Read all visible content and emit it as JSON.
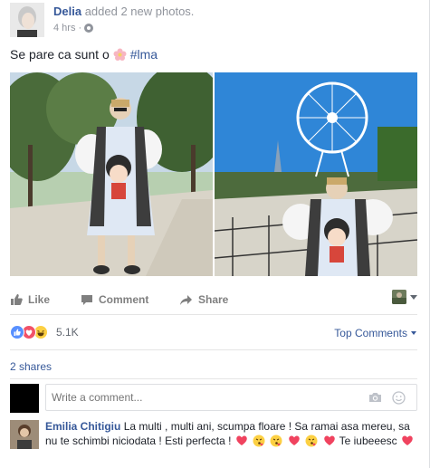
{
  "post": {
    "author": "Delia",
    "action": "added 2 new photos.",
    "time": "4 hrs",
    "text": "Se pare ca sunt o",
    "hashtag": "#lma"
  },
  "photos": [
    {
      "name": "photo-left"
    },
    {
      "name": "photo-right"
    }
  ],
  "actions": {
    "like": "Like",
    "comment": "Comment",
    "share": "Share"
  },
  "reactions": {
    "count": "5.1K",
    "top_comments": "Top Comments"
  },
  "shares": "2 shares",
  "composer": {
    "placeholder": "Write a comment..."
  },
  "comment": {
    "author": "Emilia Chitigiu",
    "part1": "La multi , multi ani, scumpa floare ! Sa ramai asa mereu, sa nu te schimbi niciodata ! Esti perfecta !",
    "part2": "Te iubeeesc"
  },
  "colors": {
    "link": "#365899",
    "meta": "#90949c",
    "like_blue": "#5890ff",
    "love_red": "#f25268",
    "heart": "#f0435f"
  },
  "icons": [
    "globe-icon",
    "flower-emoji-icon",
    "like-icon",
    "comment-icon",
    "share-icon",
    "camera-icon",
    "smiley-icon",
    "heart-emoji-icon",
    "kiss-emoji-icon"
  ]
}
